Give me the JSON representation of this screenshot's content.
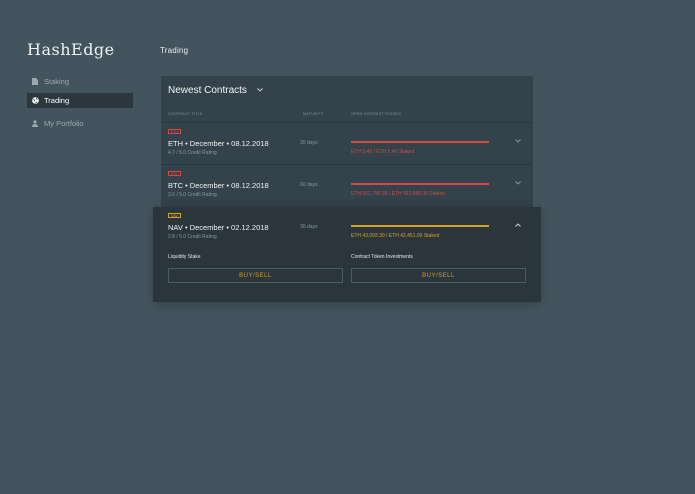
{
  "app": {
    "logo": "HashEdge"
  },
  "header": {
    "page_title": "Trading"
  },
  "sidebar": {
    "items": [
      {
        "label": "Staking",
        "icon": "document-icon",
        "active": false
      },
      {
        "label": "Trading",
        "icon": "globe-icon",
        "active": true
      },
      {
        "label": "My Portfolio",
        "icon": "person-icon",
        "active": false
      }
    ]
  },
  "panel": {
    "title": "Newest Contracts",
    "columns": {
      "contract": "CONTRACT TITLE",
      "maturity": "MATURITY",
      "open_interest": "OPEN INTEREST STAKED"
    }
  },
  "contracts": [
    {
      "tag": "ETH",
      "title": "ETH • December • 08.12.2018",
      "rating": "4.7 / 5.0 Credit Rating",
      "maturity": "30 days",
      "staked": "ETH 5.40 / ETH 5.40 Staked",
      "fill_fraction": 1.0,
      "color": "#d34a43"
    },
    {
      "tag": "BTC",
      "title": "BTC • December • 08.12.2018",
      "rating": "3.6 / 5.0 Credit Rating",
      "maturity": "60 days",
      "staked": "ETH 661,790.30 / ETH 661,690.30 Staked",
      "fill_fraction": 1.0,
      "color": "#d34a43"
    },
    {
      "tag": "NAV",
      "title": "NAV • December • 02.12.2018",
      "rating": "2.8 / 5.0 Credit Rating",
      "maturity": "30 days",
      "staked": "ETH 43,093.30 / ETH 42,451.00 Staked",
      "fill_fraction": 1.0,
      "color": "#d7a226",
      "expanded": {
        "liquidity_label": "Liquidity Stake",
        "investment_label": "Contract Token Investments",
        "liquidity_button": "BUY/SELL",
        "investment_button": "BUY/SELL"
      }
    }
  ],
  "colors": {
    "background": "#44545e",
    "panel": "#34424b",
    "expanded": "#2b363c",
    "red": "#d34a43",
    "gold": "#d7a226"
  }
}
